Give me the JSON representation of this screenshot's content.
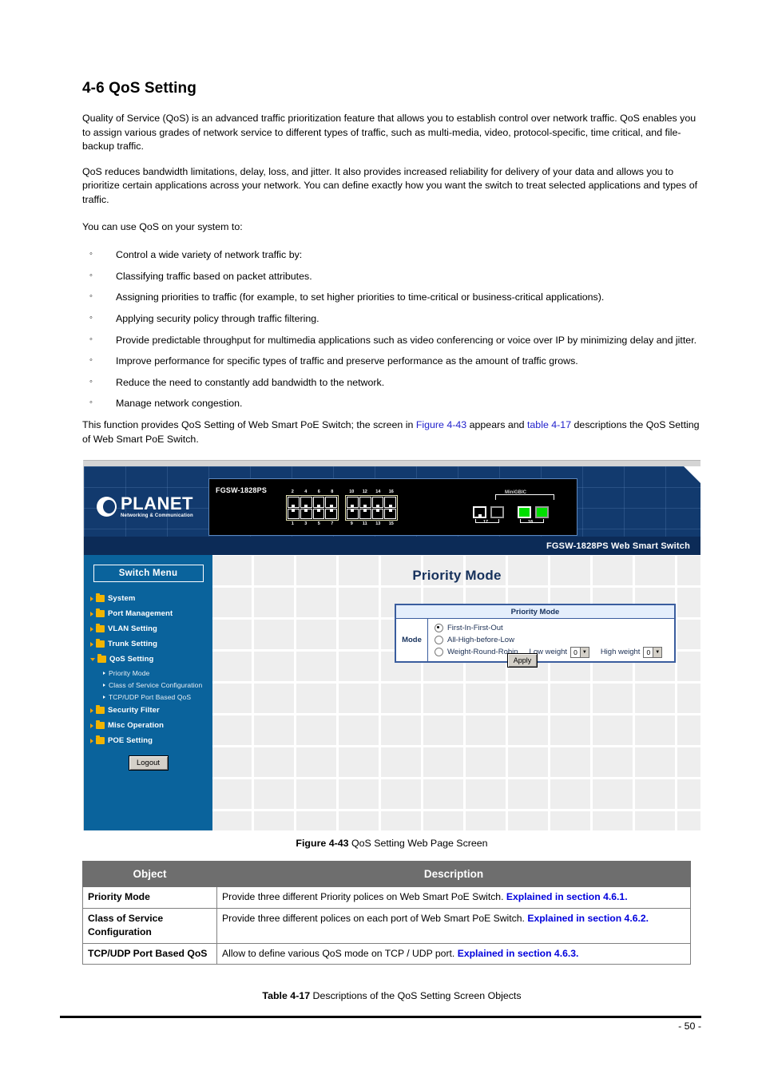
{
  "document": {
    "section_title": "4-6 QoS Setting",
    "paragraphs": [
      "Quality of Service (QoS) is an advanced traffic prioritization feature that allows you to establish control over network traffic. QoS enables you to assign various grades of network service to different types of traffic, such as multi-media, video, protocol-specific, time critical, and file-backup traffic.",
      "QoS reduces bandwidth limitations, delay, loss, and jitter. It also provides increased reliability for delivery of your data and allows you to prioritize certain applications across your network. You can define exactly how you want the switch to treat selected applications and types of traffic."
    ],
    "intro_line": "You can use QoS on your system to:",
    "bullets": [
      "Control a wide variety of network traffic by:",
      "Classifying traffic based on packet attributes.",
      "Assigning priorities to traffic (for example, to set higher priorities to time-critical or business-critical applications).",
      "Applying security policy through traffic filtering.",
      "Provide predictable throughput for multimedia applications such as video conferencing or voice over IP by minimizing delay and jitter.",
      "Improve performance for specific types of traffic and preserve performance as the amount of traffic grows.",
      "Reduce the need to constantly add bandwidth to the network.",
      "Manage network congestion."
    ],
    "closing_sentence": {
      "part1": "This function provides QoS Setting of Web Smart PoE Switch; the screen in ",
      "link1": "Figure 4-43",
      "part2": " appears and ",
      "link2": "table 4-17",
      "part3": " descriptions the QoS Setting of Web Smart PoE Switch."
    },
    "figure_caption": {
      "label": "Figure 4-43",
      "text": " QoS Setting Web Page Screen"
    },
    "table_caption": {
      "label": "Table 4-17",
      "text": " Descriptions of the QoS Setting Screen Objects"
    },
    "page_number": "- 50 -"
  },
  "screenshot": {
    "brand": {
      "wordmark": "PLANET",
      "tagline": "Networking & Communication"
    },
    "device": {
      "model": "FGSW-1828PS",
      "ports_top_a": [
        "2",
        "4",
        "6",
        "8"
      ],
      "ports_bottom_a": [
        "1",
        "3",
        "5",
        "7"
      ],
      "ports_top_b": [
        "10",
        "12",
        "14",
        "16"
      ],
      "ports_bottom_b": [
        "9",
        "11",
        "13",
        "15"
      ],
      "gbic_label": "MiniGBIC",
      "uplink_left_tag": "17",
      "uplink_right_tag": "18"
    },
    "banner_text": "FGSW-1828PS Web Smart Switch",
    "sidebar": {
      "header": "Switch Menu",
      "items": [
        {
          "label": "System",
          "expanded": false
        },
        {
          "label": "Port Management",
          "expanded": false
        },
        {
          "label": "VLAN Setting",
          "expanded": false
        },
        {
          "label": "Trunk Setting",
          "expanded": false
        },
        {
          "label": "QoS Setting",
          "expanded": true
        }
      ],
      "submenu": [
        "Priority Mode",
        "Class of Service Configuration",
        "TCP/UDP Port Based QoS"
      ],
      "items_after": [
        {
          "label": "Security Filter",
          "expanded": false
        },
        {
          "label": "Misc Operation",
          "expanded": false
        },
        {
          "label": "POE Setting",
          "expanded": false
        }
      ],
      "logout_label": "Logout"
    },
    "panel": {
      "title": "Priority Mode",
      "table_header": "Priority Mode",
      "mode_label": "Mode",
      "options": [
        {
          "label": "First-In-First-Out",
          "selected": true
        },
        {
          "label": "All-High-before-Low",
          "selected": false
        },
        {
          "label": "Weight-Round-Robin",
          "selected": false
        }
      ],
      "low_weight_label": "Low weight",
      "low_weight_value": "0",
      "high_weight_label": "High weight",
      "high_weight_value": "0",
      "apply_label": "Apply"
    }
  },
  "object_table": {
    "headers": {
      "object": "Object",
      "description": "Description"
    },
    "rows": [
      {
        "object": "Priority Mode",
        "desc_plain": "Provide three different Priority polices on Web Smart PoE Switch.  ",
        "desc_link": "Explained in section 4.6.1."
      },
      {
        "object": "Class of Service Configuration",
        "desc_plain": "Provide three different polices on each port of Web Smart PoE Switch. ",
        "desc_link": "Explained in section 4.6.2."
      },
      {
        "object": "TCP/UDP Port Based QoS",
        "desc_plain": "Allow to define various QoS mode on TCP / UDP port.  ",
        "desc_link": "Explained in section 4.6.3."
      }
    ]
  },
  "colors": {
    "sidebar_blue": "#0a639c",
    "banner_navy": "#123a6e",
    "banner_bottom_navy": "#0c2b57",
    "heading_navy": "#16315c",
    "link_blue": "#2222cc",
    "table_header_gray": "#6e6e6e",
    "accent_orange": "#f2b400",
    "led_green": "#00e000"
  }
}
